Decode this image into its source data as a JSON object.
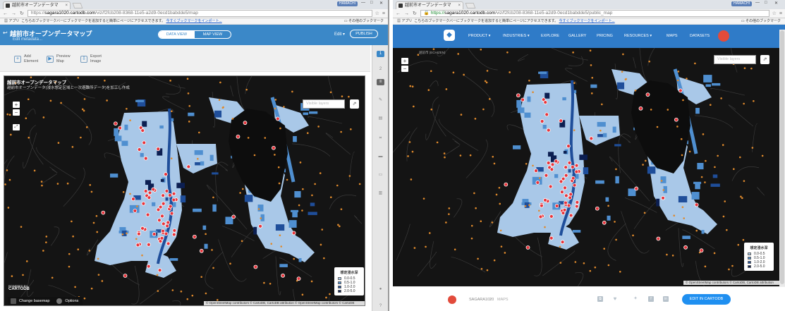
{
  "left": {
    "tab_title": "越前市オープンデータマ",
    "url_scheme": "https://",
    "url_domain": "sagara1020.cartodb.com",
    "url_path": "/viz/f2fcb208-8368-11e5-a2d9-0ecd1babdde5/map",
    "status_badge": "HAMACHI",
    "bookmarks": {
      "apps": "アプリ",
      "prompt": "こちらのブックマークバーにブックマークを追加すると簡単にページにアクセスできます。",
      "import_link": "今すぐブックマークをインポート...",
      "other": "その他のブックマーク"
    },
    "header": {
      "back": "↩",
      "map_name": "越前市オープンデータマップ",
      "metadata": "Edit metadata...",
      "data_view": "DATA VIEW",
      "map_view": "MAP VIEW",
      "edit": "Edit ▾",
      "publish": "PUBLISH"
    },
    "tools": [
      {
        "icon": "+",
        "icon_name": "add-element-icon",
        "label": "Add\nElement"
      },
      {
        "icon": "▶",
        "icon_name": "preview-icon",
        "label": "Preview\nMap"
      },
      {
        "icon": "⇩",
        "icon_name": "export-icon",
        "label": "Export\nImage"
      }
    ],
    "map_title": "越前市オープンデータマップ",
    "map_subtitle": "越前市オープンデータ(浸水想定区域と一次避難所データ)を加工し作成",
    "zoom_in": "+",
    "zoom_out": "−",
    "zoom_extra": "⤢",
    "layers_placeholder": "Visible layers",
    "share": "⇗",
    "powered_by": "POWERED BY",
    "powered_brand": "CARTODB",
    "change_basemap": "Change basemap",
    "options": "Options",
    "attribution": "© OpenStreetMap contributors © CartoDB, CartoDB attribution © OpenStreetMap contributors © CartoDB"
  },
  "right": {
    "tab_title": "越前市オープンデータマ",
    "url_scheme": "https://",
    "url_domain": "sagara1020.cartodb.com",
    "url_path": "/viz/f2fcb208-8368-11e5-a2d9-0ecd1babdde5/public_map",
    "status_badge": "HAMACHI",
    "nav": [
      "PRODUCT ▾",
      "INDUSTRIES ▾",
      "EXPLORE",
      "GALLERY",
      "PRICING",
      "RESOURCES ▾",
      "MAPS",
      "DATASETS"
    ],
    "city_label": "越前市 (ECHIZEN)",
    "zoom_in": "+",
    "zoom_out": "−",
    "layers_placeholder": "Visible layers",
    "share": "⇗",
    "attribution": "© OpenStreetMap contributors © CartoDB, CartoDB attribution",
    "footer": {
      "user": "SAGARA1020",
      "sep": "/",
      "maps": "MAPS",
      "edit_button": "EDIT IN CARTODB"
    }
  },
  "legend": {
    "title": "想定浸水深",
    "items": [
      {
        "label": "0.0-0.5",
        "color": "#a9c8e8"
      },
      {
        "label": "0.5-1.0",
        "color": "#4f8fd0"
      },
      {
        "label": "1.0-2.0",
        "color": "#1f4e9a"
      },
      {
        "label": "2.0-5.0",
        "color": "#0c1f52"
      }
    ]
  },
  "colors": {
    "editor_blue": "#3b88c8",
    "site_blue": "#2f7bc8",
    "map_bg": "#141414",
    "shelter_red": "#e8333a",
    "poi_orange": "#e08a2c",
    "lake": "#0d0d0d"
  }
}
